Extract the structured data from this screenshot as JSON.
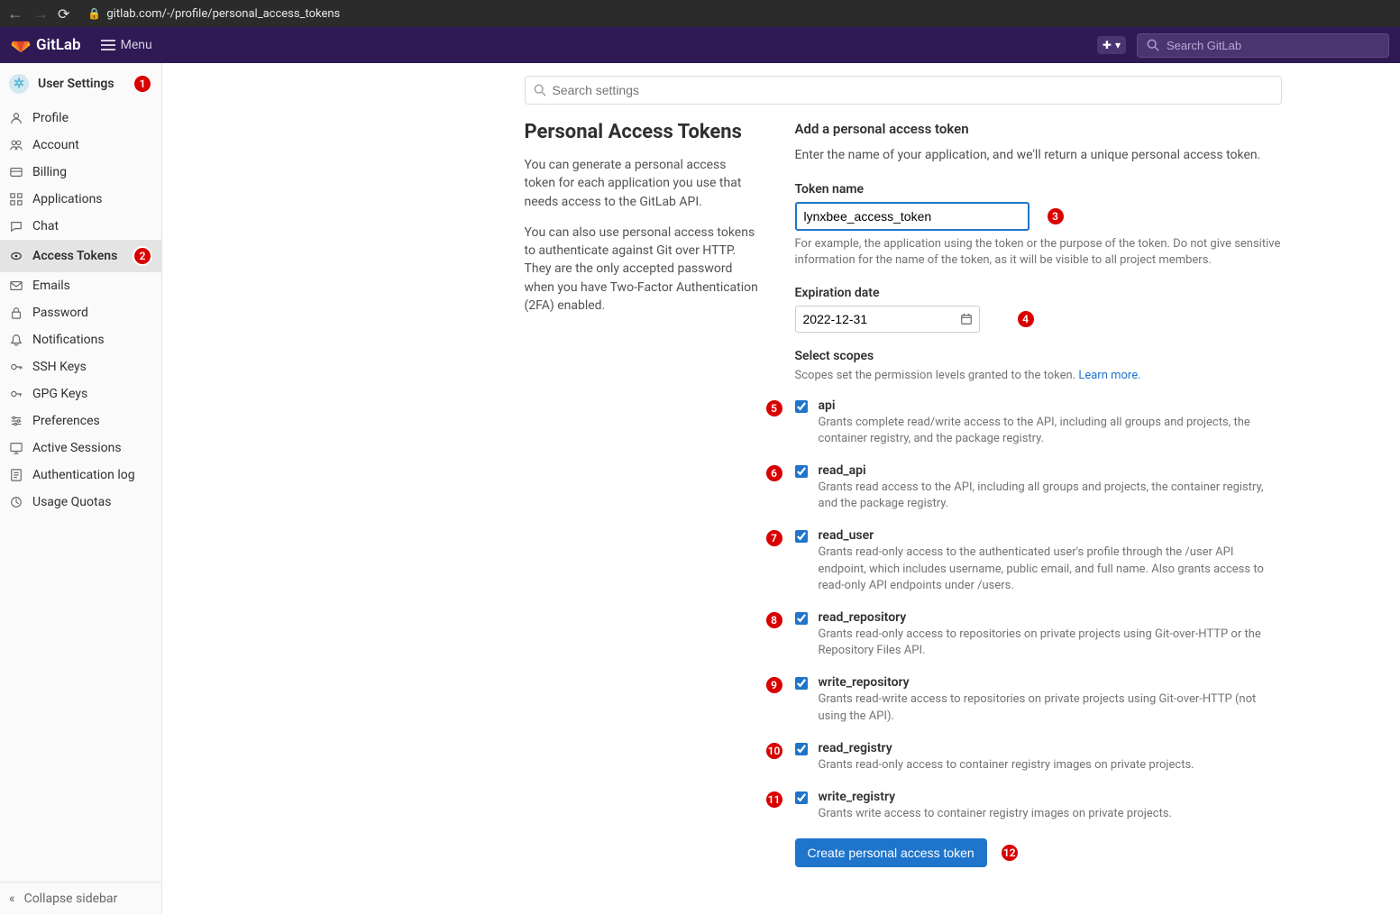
{
  "browser": {
    "url": "gitlab.com/-/profile/personal_access_tokens"
  },
  "header": {
    "brand": "GitLab",
    "menu_label": "Menu",
    "search_placeholder": "Search GitLab"
  },
  "sidebar": {
    "title": "User Settings",
    "items": [
      {
        "label": "Profile"
      },
      {
        "label": "Account"
      },
      {
        "label": "Billing"
      },
      {
        "label": "Applications"
      },
      {
        "label": "Chat"
      },
      {
        "label": "Access Tokens"
      },
      {
        "label": "Emails"
      },
      {
        "label": "Password"
      },
      {
        "label": "Notifications"
      },
      {
        "label": "SSH Keys"
      },
      {
        "label": "GPG Keys"
      },
      {
        "label": "Preferences"
      },
      {
        "label": "Active Sessions"
      },
      {
        "label": "Authentication log"
      },
      {
        "label": "Usage Quotas"
      }
    ],
    "collapse_label": "Collapse sidebar"
  },
  "settings_search": {
    "placeholder": "Search settings"
  },
  "left": {
    "title": "Personal Access Tokens",
    "p1": "You can generate a personal access token for each application you use that needs access to the GitLab API.",
    "p2": "You can also use personal access tokens to authenticate against Git over HTTP. They are the only accepted password when you have Two-Factor Authentication (2FA) enabled."
  },
  "form": {
    "heading": "Add a personal access token",
    "intro": "Enter the name of your application, and we'll return a unique personal access token.",
    "token_name_label": "Token name",
    "token_name_value": "lynxbee_access_token",
    "token_name_help": "For example, the application using the token or the purpose of the token. Do not give sensitive information for the name of the token, as it will be visible to all project members.",
    "expiration_label": "Expiration date",
    "expiration_value": "2022-12-31",
    "scopes_label": "Select scopes",
    "scopes_intro": "Scopes set the permission levels granted to the token. ",
    "scopes_learn_more": "Learn more.",
    "scopes": [
      {
        "name": "api",
        "desc": "Grants complete read/write access to the API, including all groups and projects, the container registry, and the package registry.",
        "checked": true
      },
      {
        "name": "read_api",
        "desc": "Grants read access to the API, including all groups and projects, the container registry, and the package registry.",
        "checked": true
      },
      {
        "name": "read_user",
        "desc": "Grants read-only access to the authenticated user's profile through the /user API endpoint, which includes username, public email, and full name. Also grants access to read-only API endpoints under /users.",
        "checked": true
      },
      {
        "name": "read_repository",
        "desc": "Grants read-only access to repositories on private projects using Git-over-HTTP or the Repository Files API.",
        "checked": true
      },
      {
        "name": "write_repository",
        "desc": "Grants read-write access to repositories on private projects using Git-over-HTTP (not using the API).",
        "checked": true
      },
      {
        "name": "read_registry",
        "desc": "Grants read-only access to container registry images on private projects.",
        "checked": true
      },
      {
        "name": "write_registry",
        "desc": "Grants write access to container registry images on private projects.",
        "checked": true
      }
    ],
    "create_button": "Create personal access token"
  },
  "annotations": {
    "b1": "1",
    "b2": "2",
    "b3": "3",
    "b4": "4",
    "b5": "5",
    "b6": "6",
    "b7": "7",
    "b8": "8",
    "b9": "9",
    "b10": "10",
    "b11": "11",
    "b12": "12"
  }
}
